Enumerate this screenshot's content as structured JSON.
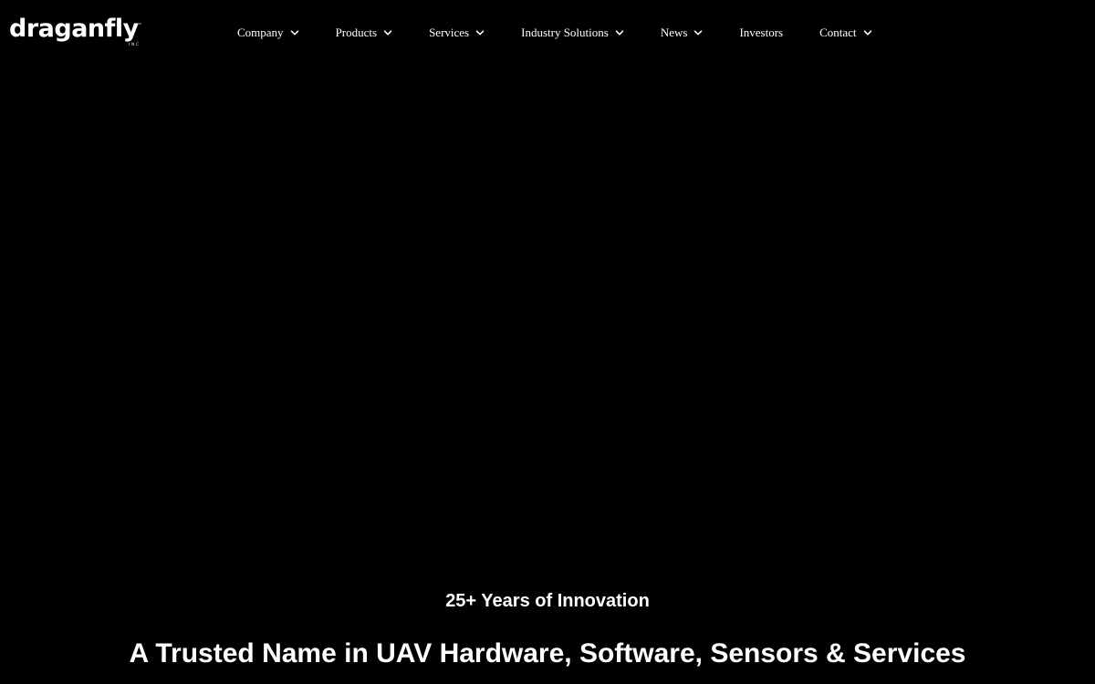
{
  "header": {
    "logo": {
      "word": "draganfly",
      "tm": "™",
      "inc": "INC"
    },
    "nav": [
      {
        "label": "Company",
        "has_dropdown": true
      },
      {
        "label": "Products",
        "has_dropdown": true
      },
      {
        "label": "Services",
        "has_dropdown": true
      },
      {
        "label": "Industry Solutions",
        "has_dropdown": true
      },
      {
        "label": "News",
        "has_dropdown": true
      },
      {
        "label": "Investors",
        "has_dropdown": false
      },
      {
        "label": "Contact",
        "has_dropdown": true
      }
    ],
    "dropdown_icon": "chevron-down-icon"
  },
  "hero": {
    "kicker": "25+ Years of Innovation",
    "title": "A Trusted Name in UAV Hardware, Software, Sensors & Services"
  },
  "colors": {
    "background": "#000000",
    "text": "#ffffff"
  }
}
